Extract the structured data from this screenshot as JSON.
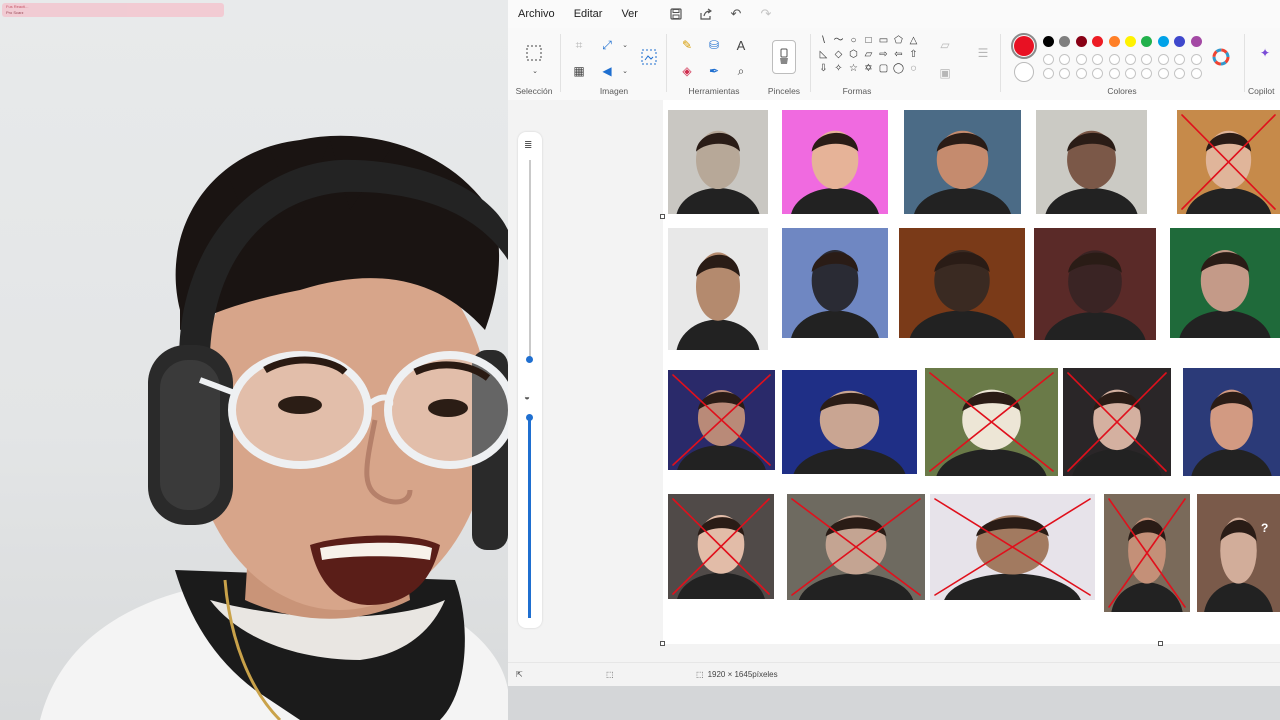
{
  "stream": {
    "line1": "Fus Reacti...",
    "line2": "Pro Scarz"
  },
  "menu": {
    "file": "Archivo",
    "edit": "Editar",
    "view": "Ver"
  },
  "ribbon": {
    "groups": {
      "selection": "Selección",
      "image": "Imagen",
      "tools": "Herramientas",
      "brushes": "Pinceles",
      "shapes": "Formas",
      "colors": "Colores",
      "copilot": "Copilot"
    },
    "text_tool_glyph": "A",
    "shape_glyphs": [
      "\\",
      "〜",
      "○",
      "□",
      "▭",
      "⬠",
      "△",
      "◺",
      "◇",
      "⬡",
      "▱",
      "⇨",
      "⇦",
      "⇧",
      "⇩",
      "✧",
      "☆",
      "✡",
      "▢",
      "◯",
      "◌"
    ],
    "primary_color": "#e81123",
    "secondary_color": "#ffffff",
    "palette_row1": [
      "#000000",
      "#7f7f7f",
      "#880015",
      "#ed1c24",
      "#ff7f27",
      "#fff200",
      "#22b14c",
      "#00a2e8",
      "#3f48cc",
      "#a349a4"
    ],
    "palette_row2": [
      "#ffffff",
      "#c3c3c3",
      "#b97a57",
      "#ffaec9",
      "#ffc90e",
      "#efe4b0",
      "#b5e61d",
      "#99d9ea",
      "#7092be",
      "#c8bfe7"
    ]
  },
  "status": {
    "dimensions": "1920 × 1645píxeles"
  },
  "colors": {
    "accent": "#1f6fd0",
    "cross_red": "#e0101c"
  },
  "canvas": {
    "thumbnails_crossed": [
      false,
      false,
      false,
      false,
      true,
      false,
      false,
      false,
      false,
      false,
      true,
      false,
      true,
      true,
      false,
      true,
      true,
      true,
      true,
      false
    ]
  },
  "overlay_mark": "?"
}
